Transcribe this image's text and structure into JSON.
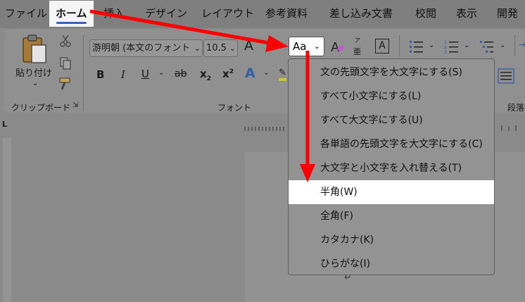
{
  "tabs": [
    {
      "label": "ファイル",
      "active": false
    },
    {
      "label": "ホーム",
      "active": true
    },
    {
      "label": "挿入",
      "active": false
    },
    {
      "label": "デザイン",
      "active": false
    },
    {
      "label": "レイアウト",
      "active": false
    },
    {
      "label": "参考資料",
      "active": false
    },
    {
      "label": "差し込み文書",
      "active": false
    },
    {
      "label": "校閲",
      "active": false
    },
    {
      "label": "表示",
      "active": false
    },
    {
      "label": "開発",
      "active": false
    }
  ],
  "clipboard": {
    "paste_label": "貼り付け",
    "group_label": "クリップボード"
  },
  "font": {
    "font_name": "游明朝 (本文のフォント",
    "font_size": "10.5",
    "group_label": "フォント",
    "change_case_label": "Aa",
    "phonetic_top": "ア",
    "phonetic_bottom": "亜",
    "bold": "B",
    "italic": "I",
    "underline": "U",
    "strike": "ab",
    "subscript": "x",
    "subscript_small": "2",
    "superscript": "x",
    "superscript_small": "2",
    "grow_font": "A",
    "text_effect": "A",
    "enclosed": "A"
  },
  "paragraph": {
    "group_label": "段落"
  },
  "change_case_menu": [
    {
      "label": "文の先頭文字を大文字にする(S)",
      "highlighted": false
    },
    {
      "label": "すべて小文字にする(L)",
      "highlighted": false
    },
    {
      "label": "すべて大文字にする(U)",
      "highlighted": false
    },
    {
      "label": "各単語の先頭文字を大文字にする(C)",
      "highlighted": false
    },
    {
      "label": "大文字と小文字を入れ替える(T)",
      "highlighted": false
    },
    {
      "label": "半角(W)",
      "highlighted": true
    },
    {
      "label": "全角(F)",
      "highlighted": false
    },
    {
      "label": "カタカナ(K)",
      "highlighted": false
    },
    {
      "label": "ひらがな(I)",
      "highlighted": false
    }
  ],
  "ruler_corner": "L",
  "paragraph_mark": "↵",
  "colors": {
    "annotation_arrow": "#ff0000",
    "highlight": "#ffffff",
    "home_underline": "#3a5fb5"
  }
}
